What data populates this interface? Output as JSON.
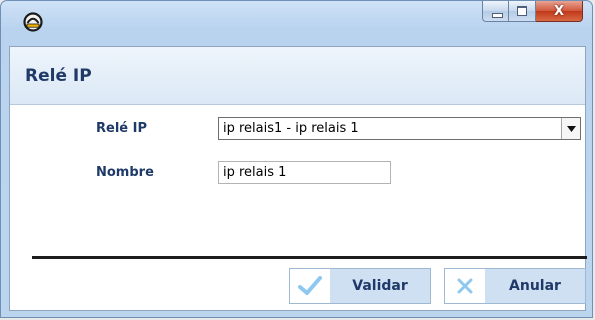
{
  "window": {
    "title": "",
    "close_glyph": "X"
  },
  "header": {
    "title": "Relé IP"
  },
  "form": {
    "rele_label": "Relé IP",
    "rele_value": "ip relais1 - ip relais 1",
    "nombre_label": "Nombre",
    "nombre_value": "ip relais 1"
  },
  "actions": {
    "validar_label": "Validar",
    "anular_label": "Anular"
  },
  "icons": {
    "app": "app-badge-icon",
    "check": "check-icon",
    "cancel": "x-icon",
    "dropdown": "chevron-down-icon"
  },
  "colors": {
    "title_text": "#1f3a68",
    "header_bg": "#dbe8f5",
    "button_bg": "#cfe0f2",
    "check_color": "#8ec8ef",
    "close_red": "#c1381a"
  }
}
